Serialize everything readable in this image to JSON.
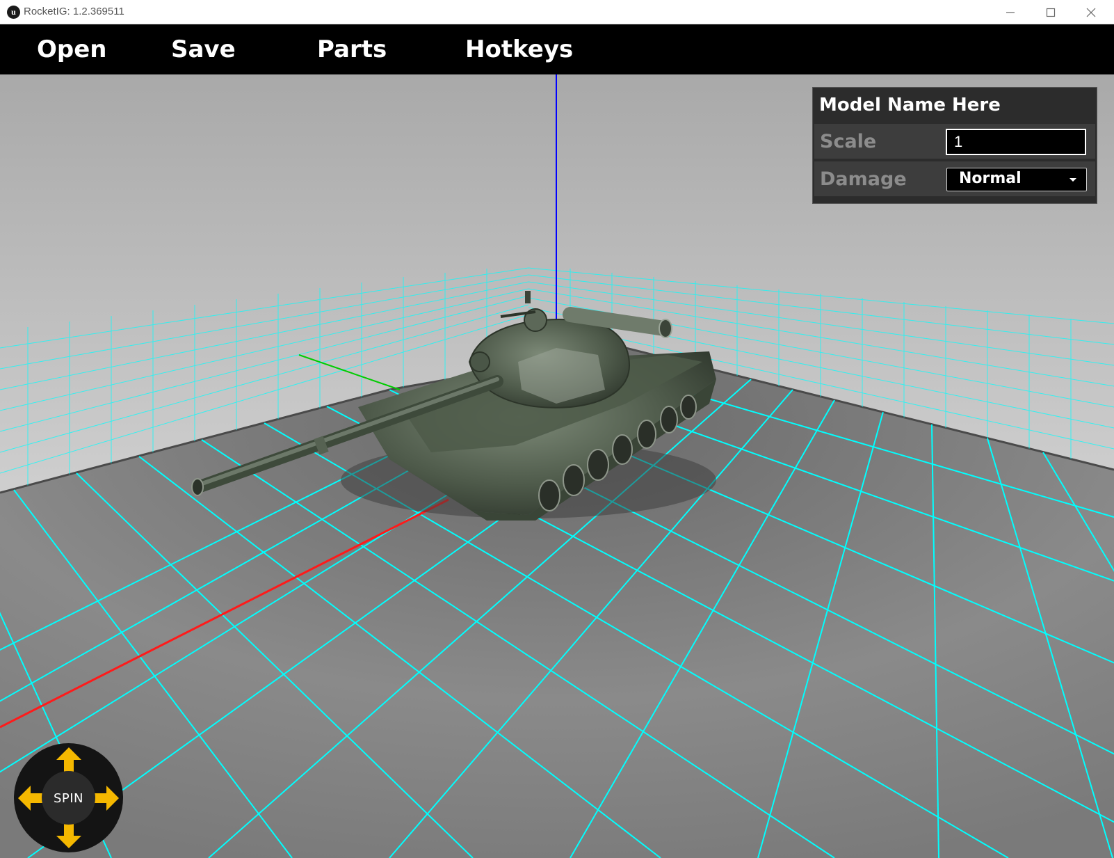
{
  "window": {
    "title": "RocketIG: 1.2.369511",
    "app_icon_glyph": "u",
    "controls": [
      "minimize-icon",
      "maximize-icon",
      "close-icon"
    ]
  },
  "menu": {
    "open": "Open",
    "save": "Save",
    "parts": "Parts",
    "hotkeys": "Hotkeys"
  },
  "panel": {
    "title": "Model Name Here",
    "scale_label": "Scale",
    "scale_value": "1",
    "damage_label": "Damage",
    "damage_value": "Normal"
  },
  "spin": {
    "label": "SPIN",
    "arrows": [
      "arrow-up-icon",
      "arrow-down-icon",
      "arrow-left-icon",
      "arrow-right-icon"
    ]
  },
  "colors": {
    "menubar": "#000000",
    "grid": "#00ffff",
    "axis_x": "#ff0000",
    "axis_y": "#00cc00",
    "axis_z": "#0000ff",
    "spin_arrow": "#f5b800",
    "panel_bg": "#2c2c2c"
  }
}
